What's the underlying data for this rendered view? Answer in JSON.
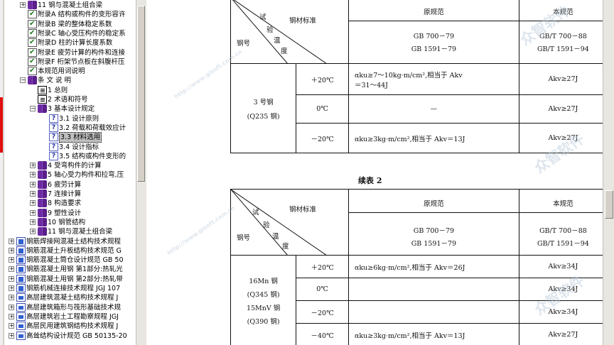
{
  "tree": {
    "items": [
      {
        "exp": "+",
        "icon": "book",
        "label": "11 钢与混凝土组合梁",
        "x": 22
      },
      {
        "exp": "",
        "icon": "check",
        "label": "附录A 结构或构件的变形容许",
        "x": 22
      },
      {
        "exp": "",
        "icon": "check",
        "label": "附录B 梁的整体稳定系数",
        "x": 22
      },
      {
        "exp": "",
        "icon": "check",
        "label": "附录C 轴心受压构件的稳定系",
        "x": 22
      },
      {
        "exp": "",
        "icon": "check",
        "label": "附录D 柱的计算长度系数",
        "x": 22
      },
      {
        "exp": "",
        "icon": "check",
        "label": "附录E 疲劳计算的构件和连接",
        "x": 22
      },
      {
        "exp": "",
        "icon": "check",
        "label": "附录F 桁架节点板在斜腹杆压",
        "x": 22
      },
      {
        "exp": "",
        "icon": "check",
        "label": "本规范用词说明",
        "x": 22
      },
      {
        "exp": "−",
        "icon": "book",
        "label": "条 文 说 明",
        "x": 22
      },
      {
        "exp": "",
        "icon": "page",
        "label": "1 总则",
        "x": 36
      },
      {
        "exp": "",
        "icon": "page",
        "label": "2 术语和符号",
        "x": 36
      },
      {
        "exp": "−",
        "icon": "book",
        "label": "3 基本设计规定",
        "x": 36
      },
      {
        "exp": "",
        "icon": "q",
        "label": "3.1 设计原则",
        "x": 52
      },
      {
        "exp": "",
        "icon": "q",
        "label": "3.2 荷载和荷载效应计",
        "x": 52
      },
      {
        "exp": "",
        "icon": "q",
        "label": "3.3 材料选用",
        "x": 52,
        "selected": true
      },
      {
        "exp": "",
        "icon": "q",
        "label": "3.4 设计指标",
        "x": 52
      },
      {
        "exp": "",
        "icon": "q",
        "label": "3.5 结构或构件变形的",
        "x": 52
      },
      {
        "exp": "+",
        "icon": "book",
        "label": "4 受弯构件的计算",
        "x": 36
      },
      {
        "exp": "+",
        "icon": "book",
        "label": "5 轴心受力构件和拉弯,压",
        "x": 36
      },
      {
        "exp": "+",
        "icon": "book",
        "label": "6 疲劳计算",
        "x": 36
      },
      {
        "exp": "+",
        "icon": "book",
        "label": "7 连接计算",
        "x": 36
      },
      {
        "exp": "+",
        "icon": "book",
        "label": "8 构造要求",
        "x": 36
      },
      {
        "exp": "+",
        "icon": "book",
        "label": "9 塑性设计",
        "x": 36
      },
      {
        "exp": "+",
        "icon": "book",
        "label": "10 钢管结构",
        "x": 36
      },
      {
        "exp": "+",
        "icon": "book",
        "label": "11 钢与混凝土组合梁",
        "x": 36
      },
      {
        "exp": "+",
        "icon": "docs",
        "label": "钢筋焊接网混凝土结构技术规程",
        "x": 6
      },
      {
        "exp": "+",
        "icon": "docs",
        "label": "钢筋混凝土升板结构技术规范 G",
        "x": 6
      },
      {
        "exp": "+",
        "icon": "docs",
        "label": "钢筋混凝土筒仓设计规范 GB 50",
        "x": 6
      },
      {
        "exp": "+",
        "icon": "docs",
        "label": "钢筋混凝土用钢 第1部分:热轧光",
        "x": 6
      },
      {
        "exp": "+",
        "icon": "docs",
        "label": "钢筋混凝土用钢 第2部分:热轧带",
        "x": 6
      },
      {
        "exp": "+",
        "icon": "docs",
        "label": "钢筋机械连接技术规程 JGJ 107",
        "x": 6
      },
      {
        "exp": "+",
        "icon": "docs2",
        "label": "高层建筑混凝土结构技术规程 J",
        "x": 6
      },
      {
        "exp": "+",
        "icon": "docs2",
        "label": "高层建筑箱形与筏形基础技术规",
        "x": 6
      },
      {
        "exp": "+",
        "icon": "docs2",
        "label": "高层建筑岩土工程勘察规程 JGJ",
        "x": 6
      },
      {
        "exp": "+",
        "icon": "docs2",
        "label": "高层民用建筑钢结构技术规程 J",
        "x": 6
      },
      {
        "exp": "+",
        "icon": "docs2",
        "label": "高耸结构设计规范 GB 50135-20",
        "x": 6
      }
    ]
  },
  "doc": {
    "hdr_steel_std": "钢材标准",
    "hdr_test": "试",
    "hdr_check": "验",
    "hdr_temp_a": "温",
    "hdr_temp_b": "度",
    "hdr_grade": "钢号",
    "hdr_old": "原规范",
    "hdr_new": "本规范",
    "t1_old_std1": "GB 700－79",
    "t1_old_std2": "GB 1591－79",
    "t1_new_std1": "GB/T 700－88",
    "t1_new_std2": "GB/T 1591－94",
    "t1_grade1": "3 号钢",
    "t1_grade2": "(Q235 钢)",
    "t1_r1_temp": "＋20℃",
    "t1_r1_old": "αku≥7～10kg·m/cm²,相当于 Akv",
    "t1_r1_old2": "＝31～44J",
    "t1_r1_new": "Akv≥27J",
    "t1_r2_temp": "0℃",
    "t1_r2_old": "—",
    "t1_r2_new": "Akv≥27J",
    "t1_r3_temp": "－20℃",
    "t1_r3_old": "αku≥3kg·m/cm²,相当于 Akv＝13J",
    "t1_r3_new": "Akv≥27J",
    "caption2": "续表 2",
    "t2_old_std1": "GB 700－79",
    "t2_old_std2": "GB 1591－79",
    "t2_new_std1": "GB/T 700－88",
    "t2_new_std2": "GB/T 1591－94",
    "t2_grade1": "16Mn 钢",
    "t2_grade2": "(Q345 钢)",
    "t2_grade3": "15MnV 钢",
    "t2_grade4": "(Q390 钢)",
    "t2_r1_temp": "＋20℃",
    "t2_r1_old": "αku≥6kg·m/cm²,相当于 Akv＝26J",
    "t2_r1_new": "Akv≥34J",
    "t2_r2_temp": "0℃",
    "t2_r2_old": "",
    "t2_r2_new": "Akv≥34J",
    "t2_r3_temp": "－20℃",
    "t2_r3_old": "",
    "t2_r3_new": "Akv≥34J",
    "t2_r4_temp": "－40℃",
    "t2_r4_old": "αku≥3kg·m/cm²,相当于 Akv＝13J",
    "t2_r4_new": "Akv≥27J"
  },
  "watermark": "众智软件",
  "watermark_url": "http://www.gisoft.com.cn"
}
